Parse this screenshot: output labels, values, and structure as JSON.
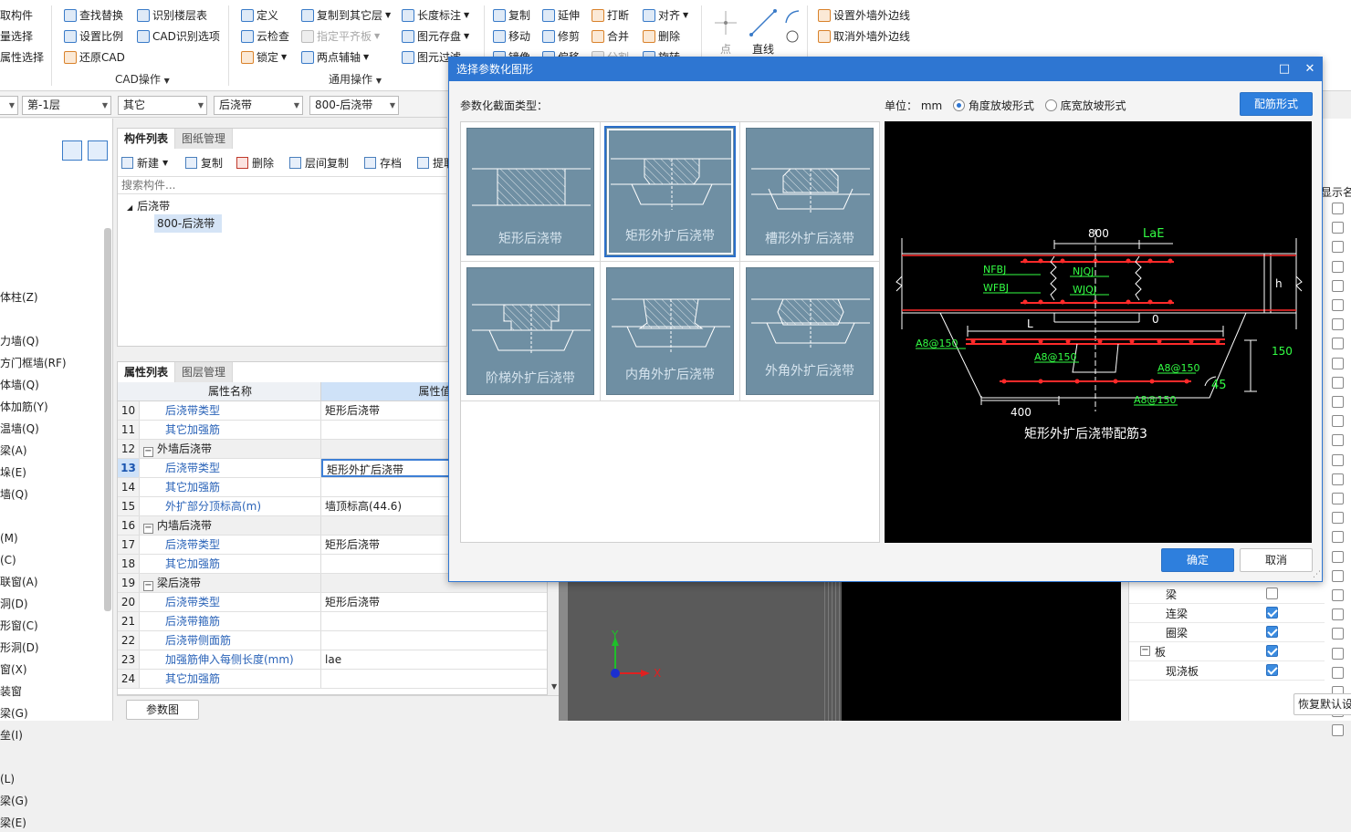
{
  "ribbon": {
    "col1": [
      "取构件",
      "量选择",
      "属性选择"
    ],
    "col2": [
      "查找替换",
      "设置比例",
      "还原CAD"
    ],
    "col3": [
      "识别楼层表",
      "CAD识别选项"
    ],
    "group_cad": "CAD操作",
    "col4": [
      "定义",
      "云检查",
      "锁定"
    ],
    "col5": [
      "复制到其它层",
      "指定平齐板",
      "两点辅轴"
    ],
    "col6": [
      "长度标注",
      "图元存盘",
      "图元过滤"
    ],
    "group_common": "通用操作",
    "col7": [
      "复制",
      "移动",
      "镜像"
    ],
    "col8": [
      "延伸",
      "修剪",
      "偏移"
    ],
    "col9": [
      "打断",
      "合并",
      "分割"
    ],
    "col10": [
      "对齐",
      "删除",
      "旋转"
    ],
    "draw_point": "点",
    "draw_line": "直线",
    "col11": [
      "设置外墙外边线",
      "取消外墙外边线"
    ]
  },
  "selbar": {
    "floor": "第-1层",
    "category": "其它",
    "type": "后浇带",
    "component": "800-后浇带"
  },
  "leftnav": [
    "体柱(Z)",
    "力墙(Q)",
    "方门框墙(RF)",
    "体墙(Q)",
    "体加筋(Y)",
    "温墙(Q)",
    "梁(A)",
    "垛(E)",
    "墙(Q)",
    "(M)",
    "(C)",
    "联窗(A)",
    "洞(D)",
    "形窗(C)",
    "形洞(D)",
    "窗(X)",
    "装窗",
    "梁(G)",
    "垒(I)",
    "(L)",
    "梁(G)",
    "梁(E)"
  ],
  "component_panel": {
    "tabs": [
      "构件列表",
      "图纸管理"
    ],
    "toolbar": [
      "新建",
      "复制",
      "删除",
      "层间复制",
      "存档",
      "提取"
    ],
    "search_placeholder": "搜索构件...",
    "tree_root": "后浇带",
    "tree_child": "800-后浇带"
  },
  "props_panel": {
    "tabs": [
      "属性列表",
      "图层管理"
    ],
    "header_name": "属性名称",
    "header_value": "属性值",
    "rows": [
      {
        "no": "10",
        "name": "后浇带类型",
        "value": "矩形后浇带"
      },
      {
        "no": "11",
        "name": "其它加强筋",
        "value": ""
      },
      {
        "no": "12",
        "name": "外墙后浇带",
        "value": ""
      },
      {
        "no": "13",
        "name": "后浇带类型",
        "value": "矩形外扩后浇带"
      },
      {
        "no": "14",
        "name": "其它加强筋",
        "value": ""
      },
      {
        "no": "15",
        "name": "外扩部分顶标高(m)",
        "value": "墙顶标高(44.6)"
      },
      {
        "no": "16",
        "name": "内墙后浇带",
        "value": ""
      },
      {
        "no": "17",
        "name": "后浇带类型",
        "value": "矩形后浇带"
      },
      {
        "no": "18",
        "name": "其它加强筋",
        "value": ""
      },
      {
        "no": "19",
        "name": "梁后浇带",
        "value": ""
      },
      {
        "no": "20",
        "name": "后浇带类型",
        "value": "矩形后浇带"
      },
      {
        "no": "21",
        "name": "后浇带箍筋",
        "value": ""
      },
      {
        "no": "22",
        "name": "后浇带侧面筋",
        "value": ""
      },
      {
        "no": "23",
        "name": "加强筋伸入每侧长度(mm)",
        "value": "lae"
      },
      {
        "no": "24",
        "name": "其它加强筋",
        "value": ""
      }
    ],
    "param_button": "参数图"
  },
  "right_panel": {
    "header": "显示名称",
    "items": [
      {
        "label": "梁",
        "checked": false
      },
      {
        "label": "连梁",
        "checked": true
      },
      {
        "label": "圈梁",
        "checked": true
      },
      {
        "label": "板",
        "checked": true
      },
      {
        "label": "现浇板",
        "checked": true
      }
    ],
    "restore_button": "恢复默认设"
  },
  "dialog": {
    "title": "选择参数化图形",
    "section_label": "参数化截面类型：",
    "unit_label": "单位：",
    "unit_value": "mm",
    "radio1": "角度放坡形式",
    "radio2": "底宽放坡形式",
    "rebar_button": "配筋形式",
    "shapes": [
      "矩形后浇带",
      "矩形外扩后浇带",
      "槽形外扩后浇带",
      "阶梯外扩后浇带",
      "内角外扩后浇带",
      "外角外扩后浇带"
    ],
    "ok": "确定",
    "cancel": "取消"
  },
  "preview": {
    "caption": "矩形外扩后浇带配筋3",
    "dim_800": "800",
    "lae": "LaE",
    "nfbj": "NFBJ",
    "njqj": "NJQJ",
    "wfbj": "WFBJ",
    "wjqj": "WJQJ",
    "h": "h",
    "zero": "0",
    "L": "L",
    "a8_1": "A8@150",
    "a8_2": "A8@150",
    "a8_3": "A8@150",
    "a8_4": "A8@150",
    "dim_150": "150",
    "angle": "45",
    "dim_400": "400"
  },
  "canvas": {
    "y_axis": "Y",
    "x_axis": "X"
  }
}
